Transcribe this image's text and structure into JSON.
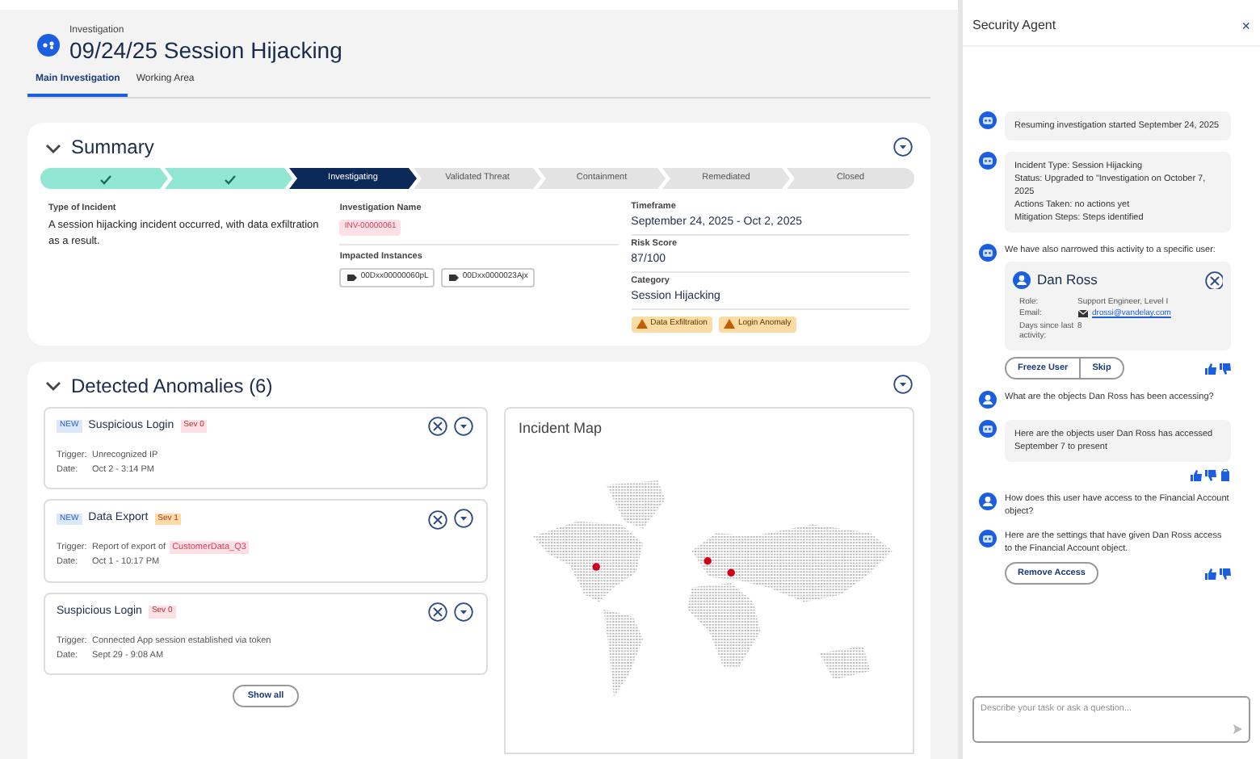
{
  "header": {
    "subtitle": "Investigation",
    "title": "09/24/25 Session Hijacking"
  },
  "tabs": [
    {
      "label": "Main Investigation",
      "selected": true
    },
    {
      "label": "Working Area",
      "selected": false
    }
  ],
  "summary": {
    "title": "Summary",
    "expanded": true,
    "steps": [
      {
        "kind": "done"
      },
      {
        "kind": "done"
      },
      {
        "label": "Investigating",
        "kind": "current"
      },
      {
        "label": "Validated Threat",
        "kind": "pending"
      },
      {
        "label": "Containment",
        "kind": "pending"
      },
      {
        "label": "Remediated",
        "kind": "pending"
      },
      {
        "label": "Closed",
        "kind": "pending"
      }
    ],
    "type_label": "Type of Incident",
    "type_value": "A session hijacking incident occurred, with data exfiltration as a result.",
    "name_label": "Investigation Name",
    "name_value": "INV-00000061",
    "instances_label": "Impacted Instances",
    "instances": [
      "00Dxx00000060pL",
      "00Dxx0000023Ajx"
    ],
    "fields": [
      {
        "label": "Timeframe",
        "value": "September 24, 2025 - Oct 2, 2025"
      },
      {
        "label": "Risk Score",
        "value": "87/100"
      },
      {
        "label": "Category",
        "value": "Session Hijacking"
      }
    ],
    "tags": [
      "Data Exfiltration",
      "Login Anomaly"
    ]
  },
  "anomalies": {
    "title": "Detected Anomalies (6)",
    "expanded": true,
    "cards": [
      {
        "is_new": true,
        "new_label": "NEW",
        "title": "Suspicious Login",
        "severity": "Sev 0",
        "color": "#fde0e6",
        "trigger_label": "Trigger:",
        "trigger": "Unrecognized IP",
        "date_label": "Date:",
        "date": "Oct 2 - 3:14 PM"
      },
      {
        "is_new": true,
        "new_label": "NEW",
        "title": "Data Export",
        "severity": "Sev 1",
        "color": "#fcdca4",
        "trigger_label": "Trigger:",
        "trigger": "Report of export of",
        "trigger_tag": "CustomerData_Q3",
        "date_label": "Date:",
        "date": "Oct 1 - 10:17 PM"
      },
      {
        "is_new": false,
        "title": "Suspicious Login",
        "severity": "Sev 0",
        "color": "#fde0e6",
        "trigger_label": "Trigger:",
        "trigger": "Connected App session established via token",
        "date_label": "Date:",
        "date": "Sept 29 - 9:08 AM"
      }
    ],
    "show_all": "Show all",
    "map": {
      "title": "Incident Map"
    }
  },
  "agent": {
    "title": "Security Agent",
    "close": "×",
    "messages": [
      {
        "kind": "agent_bubble",
        "lines": [
          "Resuming investigation started September 24, 2025"
        ]
      },
      {
        "kind": "agent_bubble",
        "lines": [
          "Incident Type: Session Hijacking",
          "Status: Upgraded to \"Investigation on October 7, 2025",
          "Actions Taken: no actions yet",
          "Mitigation Steps: Steps identified"
        ]
      },
      {
        "kind": "agent_text",
        "lines": [
          "We have also narrowed this activity to a specific user:"
        ],
        "user_card": {
          "name": "Dan Ross",
          "rows": [
            {
              "label": "Role:",
              "value": "Support Engineer, Level I"
            },
            {
              "label": "Email:",
              "value": "drossi@vandelay.com",
              "kind": "email"
            },
            {
              "label": "Days since last activity:",
              "value": "8"
            }
          ]
        },
        "buttons": [
          "Freeze User",
          "Skip"
        ],
        "feedback": [
          {
            "kind": "up"
          },
          {
            "kind": "down"
          }
        ]
      },
      {
        "kind": "user",
        "lines": [
          "What are the objects Dan Ross has been accessing?"
        ]
      },
      {
        "kind": "agent_bubble",
        "lines": [
          "Here are the objects user Dan Ross has accessed September 7 to present"
        ],
        "feedback": [
          {
            "kind": "up"
          },
          {
            "kind": "down"
          },
          {
            "kind": "copy"
          }
        ]
      },
      {
        "kind": "user",
        "lines": [
          "How does this user have access to the Financial Account object?"
        ]
      },
      {
        "kind": "agent_text",
        "lines": [
          "Here are the settings that have given Dan Ross access to the Financial Account object."
        ],
        "buttons": [
          "Remove Access"
        ],
        "feedback": [
          {
            "kind": "up"
          },
          {
            "kind": "down"
          }
        ]
      }
    ],
    "input": {
      "placeholder": "Describe your task or ask a question..."
    }
  }
}
